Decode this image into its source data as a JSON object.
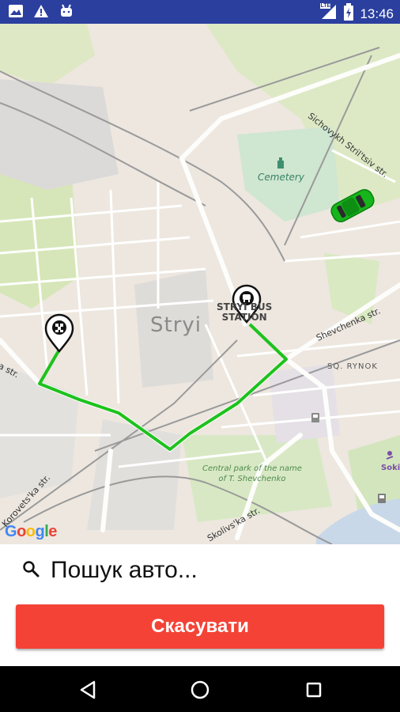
{
  "status_bar": {
    "time": "13:46",
    "network_badge": "LTE",
    "icons": [
      "gallery-icon",
      "warning-icon",
      "android-icon",
      "signal-icon",
      "battery-icon"
    ]
  },
  "map": {
    "city_label": "Stryi",
    "labels": {
      "cemetery": "Cemetery",
      "street_sichovykh": "Sichovykh Stril'tsiv str.",
      "bus_station": "STRYI BUS\nSTATION",
      "shevchenka": "Shevchenka str.",
      "rynok": "SQ. RYNOK",
      "park": "Central park of the name\nof T. Shevchenko",
      "korovets": "Korovets'ka str.",
      "skolivska": "Skolivs'ka str.",
      "sokil": "Sokil",
      "left_street": "a str."
    },
    "attribution": "Google",
    "route_color": "#1ec21e",
    "car_color": "#16b51b"
  },
  "search": {
    "status_text": "Пошук авто..."
  },
  "cancel_button": {
    "label": "Скасувати",
    "color": "#f44336"
  },
  "nav": {
    "buttons": [
      "back-icon",
      "home-icon",
      "recents-icon"
    ]
  }
}
